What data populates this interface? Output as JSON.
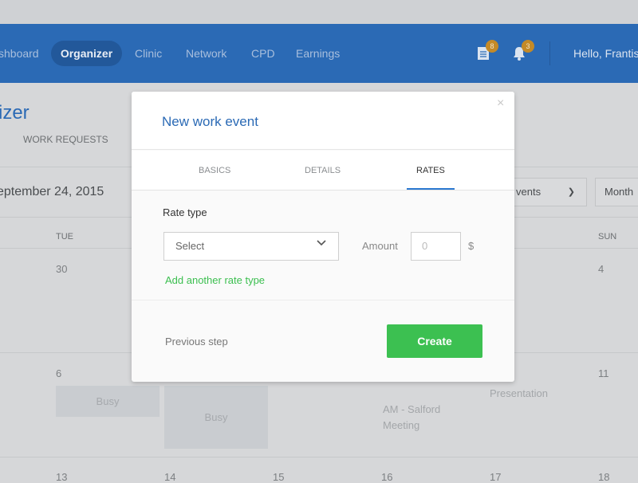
{
  "nav": {
    "items": [
      "shboard",
      "Organizer",
      "Clinic",
      "Network",
      "CPD",
      "Earnings"
    ],
    "active": "Organizer",
    "documents_badge": "8",
    "notifications_badge": "3",
    "greeting": "Hello, Frantis"
  },
  "page": {
    "title": "izer",
    "tab": "WORK REQUESTS",
    "date": "eptember 24, 2015",
    "filter": "vents",
    "view": "Month"
  },
  "calendar": {
    "day_headers": {
      "tue": "TUE",
      "sun": "SUN"
    },
    "days": {
      "d30": "30",
      "d4": "4",
      "d6": "6",
      "d11": "11",
      "d13": "13",
      "d14": "14",
      "d15": "15",
      "d16": "16",
      "d17": "17",
      "d18": "18"
    },
    "events": {
      "busy1": "Busy",
      "busy2": "Busy",
      "salford1": "AM - Salford",
      "salford2": "Meeting",
      "presentation": "Presentation"
    }
  },
  "modal": {
    "title": "New work event",
    "close": "×",
    "tabs": [
      "BASICS",
      "DETAILS",
      "RATES"
    ],
    "active_tab": "RATES",
    "rate_type_label": "Rate type",
    "select_placeholder": "Select",
    "amount_label": "Amount",
    "amount_placeholder": "0",
    "currency": "$",
    "add_rate": "Add another rate type",
    "previous": "Previous step",
    "create": "Create"
  },
  "colors": {
    "brand": "#2b6ab5",
    "create": "#3cc051",
    "badge": "#c48a27"
  }
}
